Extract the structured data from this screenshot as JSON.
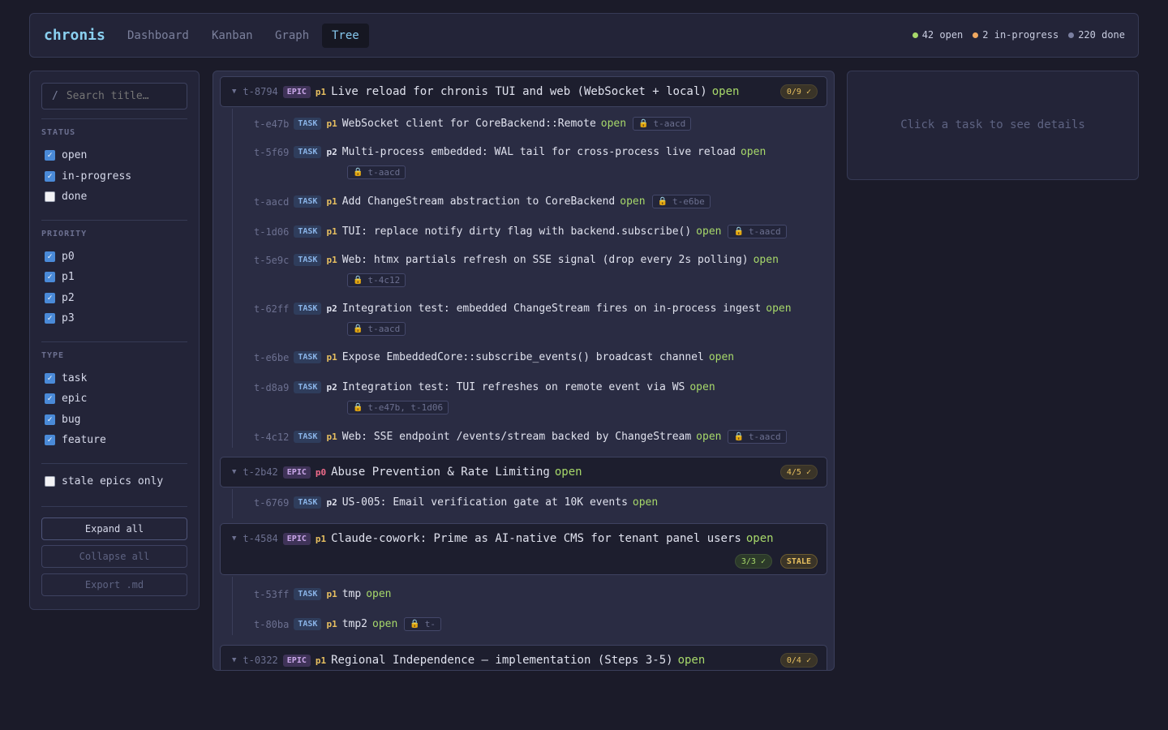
{
  "app": {
    "brand": "chronis"
  },
  "nav": {
    "tabs": [
      {
        "label": "Dashboard",
        "active": false
      },
      {
        "label": "Kanban",
        "active": false
      },
      {
        "label": "Graph",
        "active": false
      },
      {
        "label": "Tree",
        "active": true
      }
    ]
  },
  "stats": [
    {
      "text": "42 open",
      "color": "#a7d86a"
    },
    {
      "text": "2 in-progress",
      "color": "#f0a860"
    },
    {
      "text": "220 done",
      "color": "#7a7fa0"
    }
  ],
  "sidebar": {
    "search_placeholder": "Search title…",
    "search_prefix": "/",
    "status_label": "STATUS",
    "status": [
      {
        "label": "open",
        "checked": true
      },
      {
        "label": "in-progress",
        "checked": true
      },
      {
        "label": "done",
        "checked": false
      }
    ],
    "priority_label": "PRIORITY",
    "priority": [
      {
        "label": "p0",
        "checked": true
      },
      {
        "label": "p1",
        "checked": true
      },
      {
        "label": "p2",
        "checked": true
      },
      {
        "label": "p3",
        "checked": true
      }
    ],
    "type_label": "TYPE",
    "type": [
      {
        "label": "task",
        "checked": true
      },
      {
        "label": "epic",
        "checked": true
      },
      {
        "label": "bug",
        "checked": true
      },
      {
        "label": "feature",
        "checked": true
      }
    ],
    "stale_label": "stale epics only",
    "stale_checked": false,
    "expand_all": "Expand all",
    "collapse_all": "Collapse all",
    "export": "Export .md"
  },
  "tree": {
    "epics": [
      {
        "id": "t-8794",
        "type": "EPIC",
        "priority": "p1",
        "title": "Live reload for chronis TUI and web (WebSocket + local)",
        "status": "open",
        "progress": "0/9 ✓",
        "tasks": [
          {
            "id": "t-e47b",
            "type": "TASK",
            "priority": "p1",
            "title": "WebSocket client for CoreBackend::Remote",
            "status": "open",
            "blocked_by": "t-aacd"
          },
          {
            "id": "t-5f69",
            "type": "TASK",
            "priority": "p2",
            "title": "Multi-process embedded: WAL tail for cross-process live reload",
            "status": "open",
            "blocked_by": "t-aacd"
          },
          {
            "id": "t-aacd",
            "type": "TASK",
            "priority": "p1",
            "title": "Add ChangeStream abstraction to CoreBackend",
            "status": "open",
            "blocked_by": "t-e6be"
          },
          {
            "id": "t-1d06",
            "type": "TASK",
            "priority": "p1",
            "title": "TUI: replace notify dirty flag with backend.subscribe()",
            "status": "open",
            "blocked_by": "t-aacd"
          },
          {
            "id": "t-5e9c",
            "type": "TASK",
            "priority": "p1",
            "title": "Web: htmx partials refresh on SSE signal (drop every 2s polling)",
            "status": "open",
            "blocked_by": "t-4c12"
          },
          {
            "id": "t-62ff",
            "type": "TASK",
            "priority": "p2",
            "title": "Integration test: embedded ChangeStream fires on in-process ingest",
            "status": "open",
            "blocked_by": "t-aacd"
          },
          {
            "id": "t-e6be",
            "type": "TASK",
            "priority": "p1",
            "title": "Expose EmbeddedCore::subscribe_events() broadcast channel",
            "status": "open",
            "blocked_by": null
          },
          {
            "id": "t-d8a9",
            "type": "TASK",
            "priority": "p2",
            "title": "Integration test: TUI refreshes on remote event via WS",
            "status": "open",
            "blocked_by": "t-e47b, t-1d06"
          },
          {
            "id": "t-4c12",
            "type": "TASK",
            "priority": "p1",
            "title": "Web: SSE endpoint /events/stream backed by ChangeStream",
            "status": "open",
            "blocked_by": "t-aacd"
          }
        ]
      },
      {
        "id": "t-2b42",
        "type": "EPIC",
        "priority": "p0",
        "title": "Abuse Prevention & Rate Limiting",
        "status": "open",
        "progress": "4/5 ✓",
        "tasks": [
          {
            "id": "t-6769",
            "type": "TASK",
            "priority": "p2",
            "title": "US-005: Email verification gate at 10K events",
            "status": "open",
            "blocked_by": null
          }
        ]
      },
      {
        "id": "t-4584",
        "type": "EPIC",
        "priority": "p1",
        "title": "Claude-cowork: Prime as AI-native CMS for tenant panel users",
        "status": "open",
        "progress": "3/3 ✓",
        "stale": "STALE",
        "tasks": [
          {
            "id": "t-53ff",
            "type": "TASK",
            "priority": "p1",
            "title": "tmp",
            "status": "open",
            "blocked_by": null
          },
          {
            "id": "t-80ba",
            "type": "TASK",
            "priority": "p1",
            "title": "tmp2",
            "status": "open",
            "blocked_by": "t-"
          }
        ]
      },
      {
        "id": "t-0322",
        "type": "EPIC",
        "priority": "p1",
        "title": "Regional Independence — implementation (Steps 3-5)",
        "status": "open",
        "progress": "0/4 ✓",
        "tasks": []
      }
    ]
  },
  "detail": {
    "placeholder": "Click a task to see details"
  },
  "icons": {
    "caret": "caret-down-icon",
    "lock": "lock-icon",
    "check": "check-icon"
  }
}
